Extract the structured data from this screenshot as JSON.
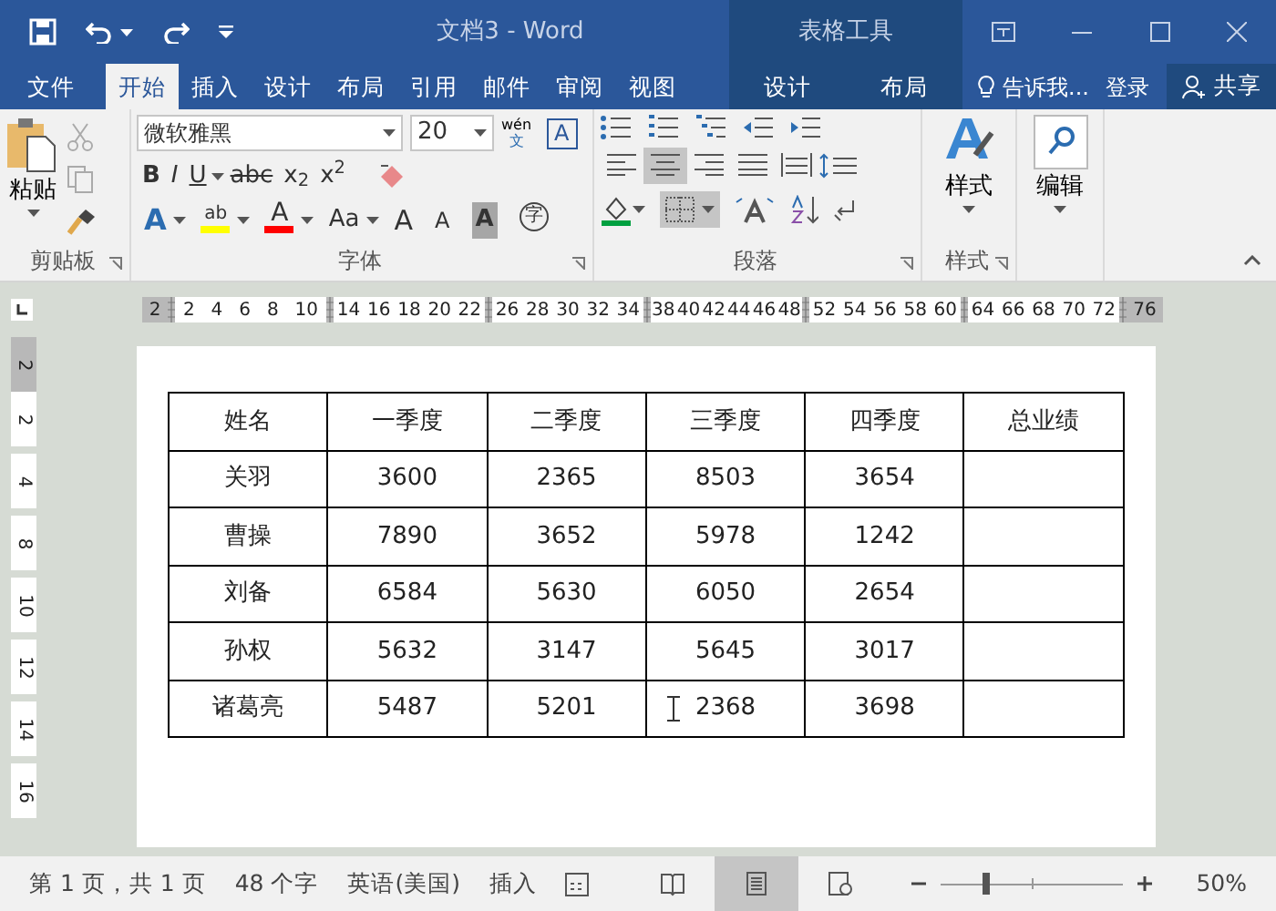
{
  "window": {
    "title": "文档3 - Word",
    "context_header": "表格工具"
  },
  "tabs": [
    {
      "label": "文件",
      "selected": false,
      "kind": "file"
    },
    {
      "label": "开始",
      "selected": true,
      "kind": "tab"
    },
    {
      "label": "插入",
      "selected": false,
      "kind": "tab"
    },
    {
      "label": "设计",
      "selected": false,
      "kind": "tab"
    },
    {
      "label": "布局",
      "selected": false,
      "kind": "tab"
    },
    {
      "label": "引用",
      "selected": false,
      "kind": "tab"
    },
    {
      "label": "邮件",
      "selected": false,
      "kind": "tab"
    },
    {
      "label": "审阅",
      "selected": false,
      "kind": "tab"
    },
    {
      "label": "视图",
      "selected": false,
      "kind": "tab"
    },
    {
      "label": "设计",
      "selected": false,
      "kind": "context"
    },
    {
      "label": "布局",
      "selected": false,
      "kind": "context"
    }
  ],
  "tell_me": "告诉我...",
  "sign_in": "登录",
  "share": "共享",
  "clipboard": {
    "paste": "粘贴",
    "group": "剪贴板"
  },
  "font": {
    "name": "微软雅黑",
    "size": "20",
    "phonetic_top": "wén",
    "phonetic_bottom": "文",
    "border_char": "A",
    "group": "字体",
    "format_buttons": [
      {
        "label": "B",
        "dropdown": false
      },
      {
        "label": "I",
        "dropdown": false
      },
      {
        "label": "U",
        "dropdown": true
      },
      {
        "label": "abc",
        "dropdown": false
      },
      {
        "label": "x$_{2}$",
        "dropdown": false
      },
      {
        "label": "x$^{2}$",
        "dropdown": false
      }
    ],
    "effect_buttons": [
      {
        "label": "A",
        "kind": "effect",
        "dropdown": true
      },
      {
        "label": "ab",
        "kind": "highlight",
        "color": "#ffff00",
        "dropdown": true
      },
      {
        "label": "A",
        "kind": "color",
        "color": "#ff0000",
        "dropdown": true
      },
      {
        "label": "Aa",
        "kind": "case",
        "dropdown": true
      },
      {
        "label": "A",
        "kind": "grow",
        "dropdown": false
      },
      {
        "label": "A",
        "kind": "shrink",
        "dropdown": false
      },
      {
        "label": "A",
        "kind": "shade",
        "dropdown": false
      },
      {
        "label": "字",
        "kind": "enclose",
        "dropdown": false
      }
    ]
  },
  "paragraph": {
    "group": "段落",
    "align_buttons": [
      {
        "selected": false
      },
      {
        "selected": true
      },
      {
        "selected": false
      },
      {
        "selected": false
      },
      {
        "selected": false
      }
    ],
    "borders_selected": true
  },
  "styles": {
    "label": "样式",
    "group": "样式"
  },
  "editing": {
    "label": "编辑"
  },
  "ruler": {
    "segments": [
      [
        "2"
      ],
      [
        "2",
        "4",
        "6",
        "8",
        "10"
      ],
      [
        "14",
        "16",
        "18",
        "20",
        "22"
      ],
      [
        "26",
        "28",
        "30",
        "32",
        "34"
      ],
      [
        "38",
        "40",
        "42",
        "44",
        "46",
        "48"
      ],
      [
        "52",
        "54",
        "56",
        "58",
        "60"
      ],
      [
        "64",
        "66",
        "68",
        "70",
        "72"
      ],
      [
        "76"
      ]
    ],
    "vertical": [
      "2",
      "2",
      "4",
      "8",
      "10",
      "12",
      "14",
      "16"
    ]
  },
  "table": {
    "columns": [
      "姓名",
      "一季度",
      "二季度",
      "三季度",
      "四季度",
      "总业绩"
    ],
    "rows": [
      [
        "关羽",
        "3600",
        "2365",
        "8503",
        "3654",
        ""
      ],
      [
        "曹操",
        "7890",
        "3652",
        "5978",
        "1242",
        ""
      ],
      [
        "刘备",
        "6584",
        "5630",
        "6050",
        "2654",
        ""
      ],
      [
        "孙权",
        "5632",
        "3147",
        "5645",
        "3017",
        ""
      ],
      [
        "诸葛亮",
        "5487",
        "5201",
        "2368",
        "3698",
        ""
      ]
    ]
  },
  "status_bar": {
    "page": "第 1 页，共 1 页",
    "words": "48 个字",
    "language": "英语(美国)",
    "mode": "插入",
    "views": [
      {
        "kind": "read",
        "selected": false
      },
      {
        "kind": "print",
        "selected": true
      },
      {
        "kind": "web",
        "selected": false
      }
    ],
    "zoom_slider": {
      "level": 0.24
    },
    "zoom": "50%"
  }
}
